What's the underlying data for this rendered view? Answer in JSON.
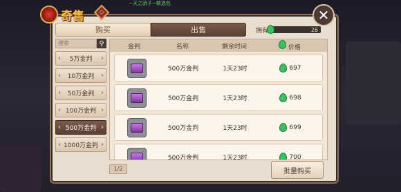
{
  "header": {
    "title": "奇售",
    "badge": "◇",
    "top_note": "~天之骄子~精选包",
    "close_glyph": "✕"
  },
  "tabs": [
    {
      "label": "购买"
    },
    {
      "label": "出售"
    }
  ],
  "owned": {
    "label": "拥有",
    "value": "26"
  },
  "search": {
    "placeholder": "搜索",
    "icon": "search-icon"
  },
  "categories": [
    {
      "label": "5万金判"
    },
    {
      "label": "10万金判"
    },
    {
      "label": "50万金判"
    },
    {
      "label": "100万金判"
    },
    {
      "label": "500万金判"
    },
    {
      "label": "1000万金判"
    }
  ],
  "selected_category": "500万金判",
  "table": {
    "headers": [
      "金判",
      "名称",
      "剩余时间",
      "价格"
    ],
    "rows": [
      {
        "name": "500万金判",
        "time": "1天23时",
        "price": "697"
      },
      {
        "name": "500万金判",
        "time": "1天23时",
        "price": "698"
      },
      {
        "name": "500万金判",
        "time": "1天23时",
        "price": "699"
      },
      {
        "name": "500万金判",
        "time": "1天23时",
        "price": "700"
      }
    ]
  },
  "pager": {
    "text": "1/2"
  },
  "bulk_button": {
    "label": "批量购买"
  },
  "colors": {
    "accent": "#f1c24b",
    "currency": "#3fbf61",
    "panel": "#e9ddcf"
  }
}
